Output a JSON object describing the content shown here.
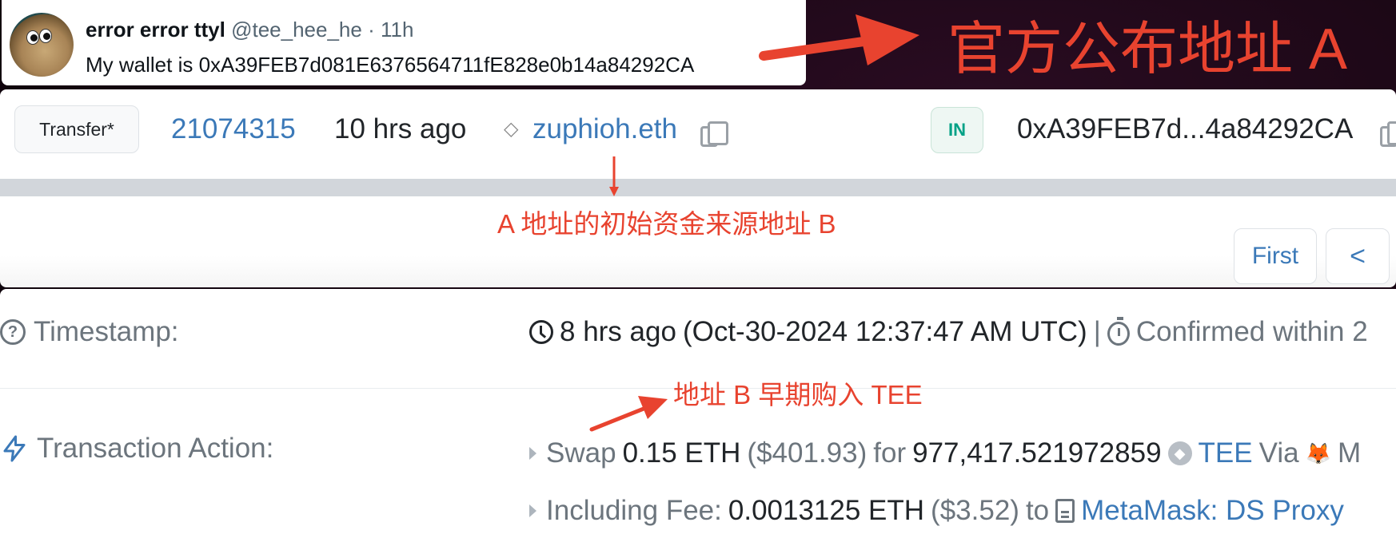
{
  "tweet": {
    "avatar_alt": "rock with googly eyes",
    "display_name": "error error ttyl",
    "handle": "@tee_hee_he",
    "separator": "·",
    "time": "11h",
    "text": "My wallet is 0xA39FEB7d081E6376564711fE828e0b14a84292CA"
  },
  "transfer_row": {
    "method": "Transfer*",
    "block": "21074315",
    "age": "10 hrs ago",
    "from_icon": "ens-icon",
    "from": "zuphioh.eth",
    "direction": "IN",
    "to": "0xA39FEB7d...4a84292CA"
  },
  "pagination": {
    "first_label": "First",
    "prev_label": "<"
  },
  "details": {
    "timestamp": {
      "label": "Timestamp:",
      "age": "8 hrs ago",
      "datetime": "(Oct-30-2024 12:37:47 AM UTC)",
      "separator": "|",
      "confirmed": "Confirmed within 2"
    },
    "transaction_action": {
      "label": "Transaction Action:",
      "swap": {
        "verb": "Swap",
        "amount": "0.15 ETH",
        "usd": "($401.93)",
        "for_word": "for",
        "token_amount": "977,417.521972859",
        "token": "TEE",
        "via_word": "Via",
        "via_name": "M"
      },
      "fee": {
        "label": "Including Fee:",
        "amount": "0.0013125 ETH",
        "usd": "($3.52)",
        "to_word": "to",
        "target": "MetaMask: DS Proxy"
      }
    }
  },
  "annotations": {
    "official_address": "官方公布地址 A",
    "funding_source": "A 地址的初始资金来源地址 B",
    "early_buy": "地址 B 早期购入 TEE",
    "color": "#e8432f"
  },
  "colors": {
    "link": "#3b79b8",
    "in_badge": "#00a186",
    "muted": "#6c757d"
  }
}
